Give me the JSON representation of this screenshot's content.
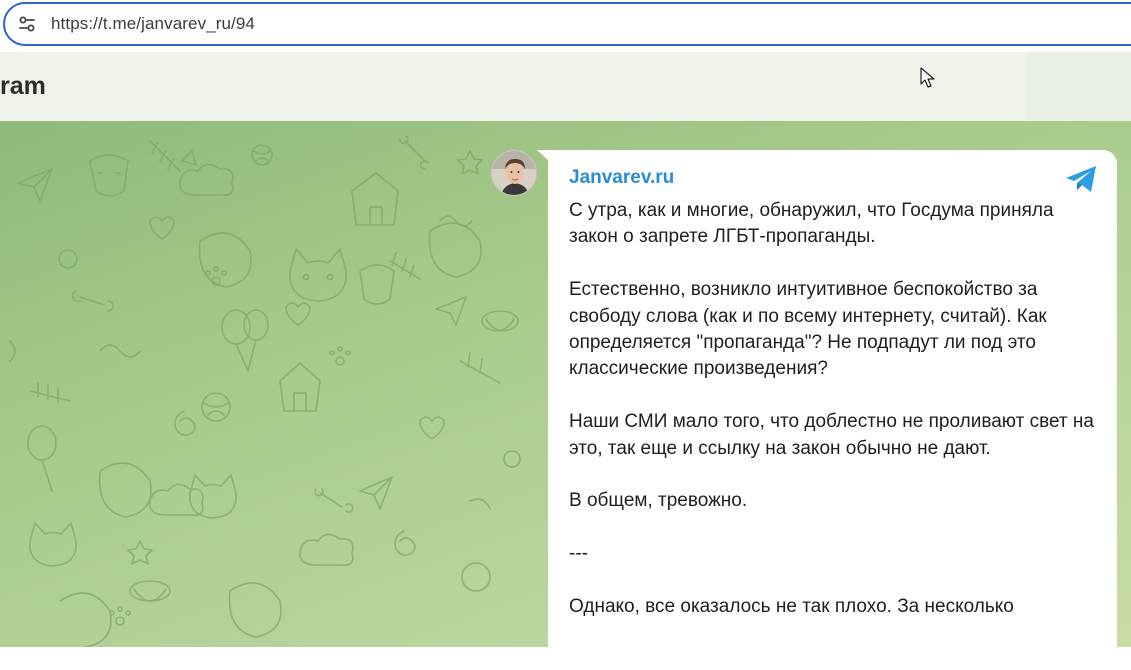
{
  "browser": {
    "url": "https://t.me/janvarev_ru/94"
  },
  "header": {
    "brand_fragment": "ram"
  },
  "post": {
    "channel_name": "Janvarev.ru",
    "paragraphs": [
      "С утра, как и многие, обнаружил, что Госдума приняла закон о запрете ЛГБТ-пропаганды.",
      "Естественно, возникло интуитивное беспокойство за свободу слова (как и по всему интернету, считай). Как определяется \"пропаганда\"? Не подпадут ли под это классические произведения?",
      "Наши СМИ мало того, что доблестно не проливают свет на это, так еще и ссылку на закон обычно не дают.",
      "В общем, тревожно.",
      "---",
      "Однако, все оказалось не так плохо. За несколько"
    ]
  },
  "colors": {
    "accent": "#2c8cd3",
    "address_border": "#2f63c9",
    "header_bg": "#eef4ea",
    "pattern_bg": "#a6c98b"
  },
  "icons": {
    "site_settings": "tune-icon",
    "telegram": "telegram-icon",
    "cursor": "mouse-pointer-icon"
  }
}
